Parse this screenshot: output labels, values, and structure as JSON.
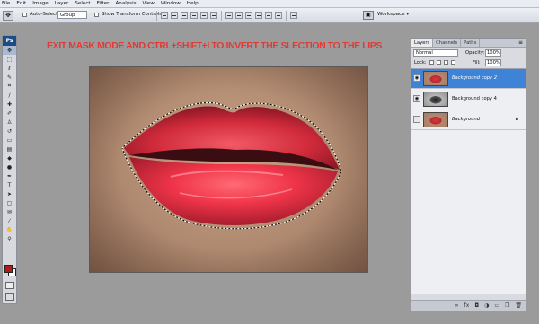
{
  "menu": [
    "File",
    "Edit",
    "Image",
    "Layer",
    "Select",
    "Filter",
    "Analysis",
    "View",
    "Window",
    "Help"
  ],
  "options_bar": {
    "auto_select_label": "Auto-Select:",
    "auto_select_value": "Group",
    "transform_label": "Show Transform Controls",
    "workspace_label": "Workspace ▾"
  },
  "tools": [
    "move",
    "marquee",
    "lasso",
    "quick-select",
    "crop",
    "slice",
    "healing",
    "brush",
    "stamp",
    "history-brush",
    "eraser",
    "gradient",
    "blur",
    "dodge",
    "pen",
    "type",
    "path-select",
    "shape",
    "notes",
    "eyedropper",
    "hand",
    "zoom"
  ],
  "foreground_color": "#b01a1a",
  "background_color": "#ffffff",
  "instruction": "EXIT MASK MODE  AND CTRL+SHIFT+I TO INVERT THE SLECTION TO THE LIPS",
  "layers_panel": {
    "tabs": [
      "Layers",
      "Channels",
      "Paths"
    ],
    "blend_mode": "Normal",
    "opacity_label": "Opacity:",
    "opacity_value": "100%",
    "lock_label": "Lock:",
    "fill_label": "Fill:",
    "fill_value": "100%",
    "layers": [
      {
        "name": "Background copy 2",
        "thumb": "color",
        "visible": true,
        "selected": true
      },
      {
        "name": "Background copy 4",
        "thumb": "bw",
        "visible": true,
        "selected": false
      },
      {
        "name": "Background",
        "thumb": "color",
        "visible": false,
        "selected": false,
        "locked": true
      }
    ]
  }
}
